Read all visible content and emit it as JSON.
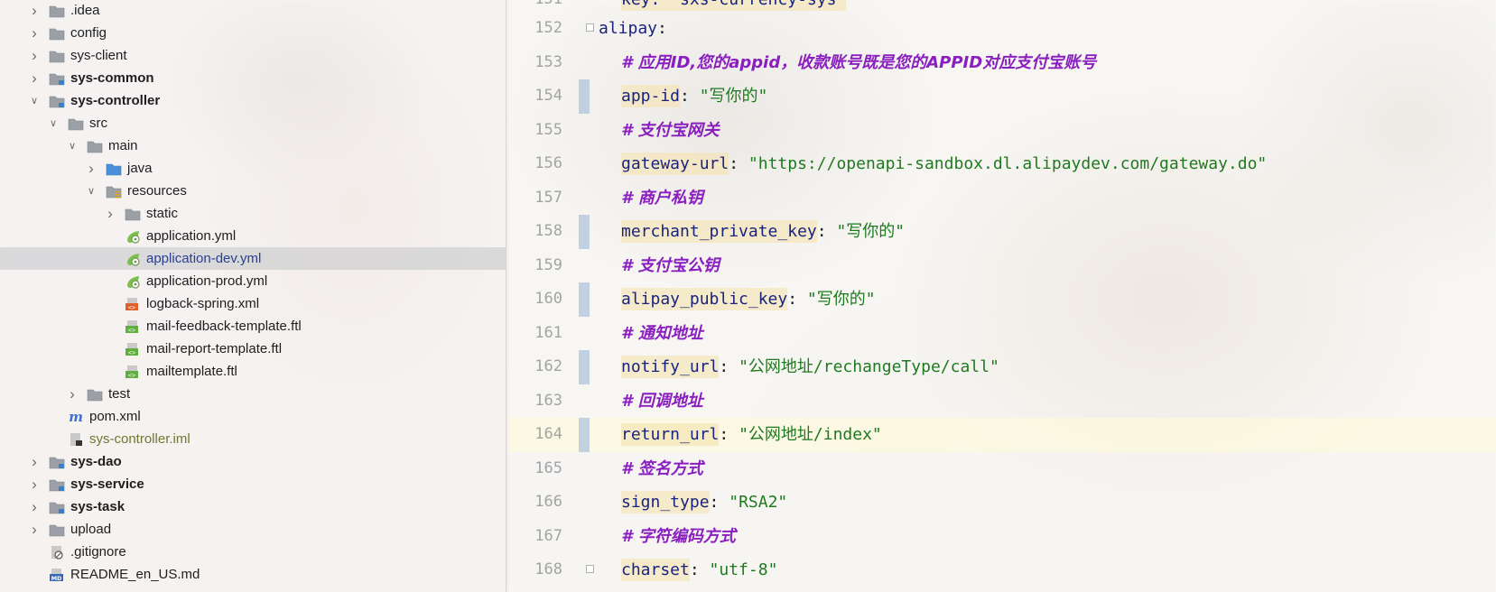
{
  "tree": {
    "items": [
      {
        "label": ".idea",
        "icon": "folder-icon",
        "depth": 0,
        "arrow": "collapsed",
        "style": "normal"
      },
      {
        "label": "config",
        "icon": "folder-icon",
        "depth": 0,
        "arrow": "collapsed",
        "style": "normal"
      },
      {
        "label": "sys-client",
        "icon": "folder-icon",
        "depth": 0,
        "arrow": "collapsed",
        "style": "normal"
      },
      {
        "label": "sys-common",
        "icon": "module-folder-icon",
        "depth": 0,
        "arrow": "collapsed",
        "style": "bold"
      },
      {
        "label": "sys-controller",
        "icon": "module-folder-icon",
        "depth": 0,
        "arrow": "expanded",
        "style": "bold"
      },
      {
        "label": "src",
        "icon": "folder-icon",
        "depth": 1,
        "arrow": "expanded",
        "style": "normal"
      },
      {
        "label": "main",
        "icon": "folder-icon",
        "depth": 2,
        "arrow": "expanded",
        "style": "normal"
      },
      {
        "label": "java",
        "icon": "source-folder-icon",
        "depth": 3,
        "arrow": "collapsed",
        "style": "normal"
      },
      {
        "label": "resources",
        "icon": "resources-folder-icon",
        "depth": 3,
        "arrow": "expanded",
        "style": "normal"
      },
      {
        "label": "static",
        "icon": "folder-icon",
        "depth": 4,
        "arrow": "collapsed",
        "style": "normal"
      },
      {
        "label": "application.yml",
        "icon": "spring-yml-icon",
        "depth": 4,
        "arrow": "none",
        "style": "normal"
      },
      {
        "label": "application-dev.yml",
        "icon": "spring-yml-icon",
        "depth": 4,
        "arrow": "none",
        "style": "blue",
        "selected": true
      },
      {
        "label": "application-prod.yml",
        "icon": "spring-yml-icon",
        "depth": 4,
        "arrow": "none",
        "style": "normal"
      },
      {
        "label": "logback-spring.xml",
        "icon": "xml-file-icon",
        "depth": 4,
        "arrow": "none",
        "style": "normal"
      },
      {
        "label": "mail-feedback-template.ftl",
        "icon": "ftl-file-icon",
        "depth": 4,
        "arrow": "none",
        "style": "normal"
      },
      {
        "label": "mail-report-template.ftl",
        "icon": "ftl-file-icon",
        "depth": 4,
        "arrow": "none",
        "style": "normal"
      },
      {
        "label": "mailtemplate.ftl",
        "icon": "ftl-file-icon",
        "depth": 4,
        "arrow": "none",
        "style": "normal"
      },
      {
        "label": "test",
        "icon": "folder-icon",
        "depth": 2,
        "arrow": "collapsed",
        "style": "normal"
      },
      {
        "label": "pom.xml",
        "icon": "maven-icon",
        "depth": 1,
        "arrow": "none",
        "style": "normal"
      },
      {
        "label": "sys-controller.iml",
        "icon": "iml-file-icon",
        "depth": 1,
        "arrow": "none",
        "style": "olive"
      },
      {
        "label": "sys-dao",
        "icon": "module-folder-icon",
        "depth": 0,
        "arrow": "collapsed",
        "style": "bold"
      },
      {
        "label": "sys-service",
        "icon": "module-folder-icon",
        "depth": 0,
        "arrow": "collapsed",
        "style": "bold"
      },
      {
        "label": "sys-task",
        "icon": "module-folder-icon",
        "depth": 0,
        "arrow": "collapsed",
        "style": "bold"
      },
      {
        "label": "upload",
        "icon": "folder-icon",
        "depth": 0,
        "arrow": "collapsed",
        "style": "normal"
      },
      {
        "label": ".gitignore",
        "icon": "gitignore-file-icon",
        "depth": 0,
        "arrow": "none",
        "style": "normal"
      },
      {
        "label": "README_en_US.md",
        "icon": "markdown-file-icon",
        "depth": 0,
        "arrow": "none",
        "style": "normal"
      }
    ]
  },
  "editor": {
    "top_partial": "key: \"sxs-currency-sys\"",
    "lines": [
      {
        "num": "152",
        "type": "top-key",
        "key": "alipay",
        "sep": ":"
      },
      {
        "num": "153",
        "type": "comment",
        "text": "# 应用ID,您的appid，收款账号既是您的APPID对应支付宝账号"
      },
      {
        "num": "154",
        "type": "pair",
        "key": "app-id",
        "sep": ": ",
        "value": "\"写你的\"",
        "marker": true
      },
      {
        "num": "155",
        "type": "comment",
        "text": "# 支付宝网关"
      },
      {
        "num": "156",
        "type": "pair",
        "key": "gateway-url",
        "sep": ": ",
        "value": "\"https://openapi-sandbox.dl.alipaydev.com/gateway.do\""
      },
      {
        "num": "157",
        "type": "comment",
        "text": "# 商户私钥"
      },
      {
        "num": "158",
        "type": "pair",
        "key": "merchant_private_key",
        "sep": ": ",
        "value": "\"写你的\"",
        "marker": true
      },
      {
        "num": "159",
        "type": "comment",
        "text": "# 支付宝公钥"
      },
      {
        "num": "160",
        "type": "pair",
        "key": "alipay_public_key",
        "sep": ": ",
        "value": "\"写你的\"",
        "marker": true
      },
      {
        "num": "161",
        "type": "comment",
        "text": "# 通知地址"
      },
      {
        "num": "162",
        "type": "pair",
        "key": "notify_url",
        "sep": ": ",
        "value": "\"公网地址/rechangeType/call\"",
        "marker": true
      },
      {
        "num": "163",
        "type": "comment",
        "text": "# 回调地址"
      },
      {
        "num": "164",
        "type": "pair",
        "key": "return_url",
        "sep": ": ",
        "value": "\"公网地址/index\"",
        "marker": true,
        "current": true
      },
      {
        "num": "165",
        "type": "comment",
        "text": "# 签名方式"
      },
      {
        "num": "166",
        "type": "pair",
        "key": "sign_type",
        "sep": ": ",
        "value": "\"RSA2\""
      },
      {
        "num": "167",
        "type": "comment",
        "text": "# 字符编码方式"
      },
      {
        "num": "168",
        "type": "pair",
        "key": "charset",
        "sep": ": ",
        "value": "\"utf-8\"",
        "fold": true
      }
    ]
  },
  "colors": {
    "key": "#1a237e",
    "string": "#1f7a1f",
    "comment": "#8a1fbf",
    "line_number": "#a3a3a3",
    "selection": "#c3c5c8",
    "current_line": "#fcfadc"
  }
}
